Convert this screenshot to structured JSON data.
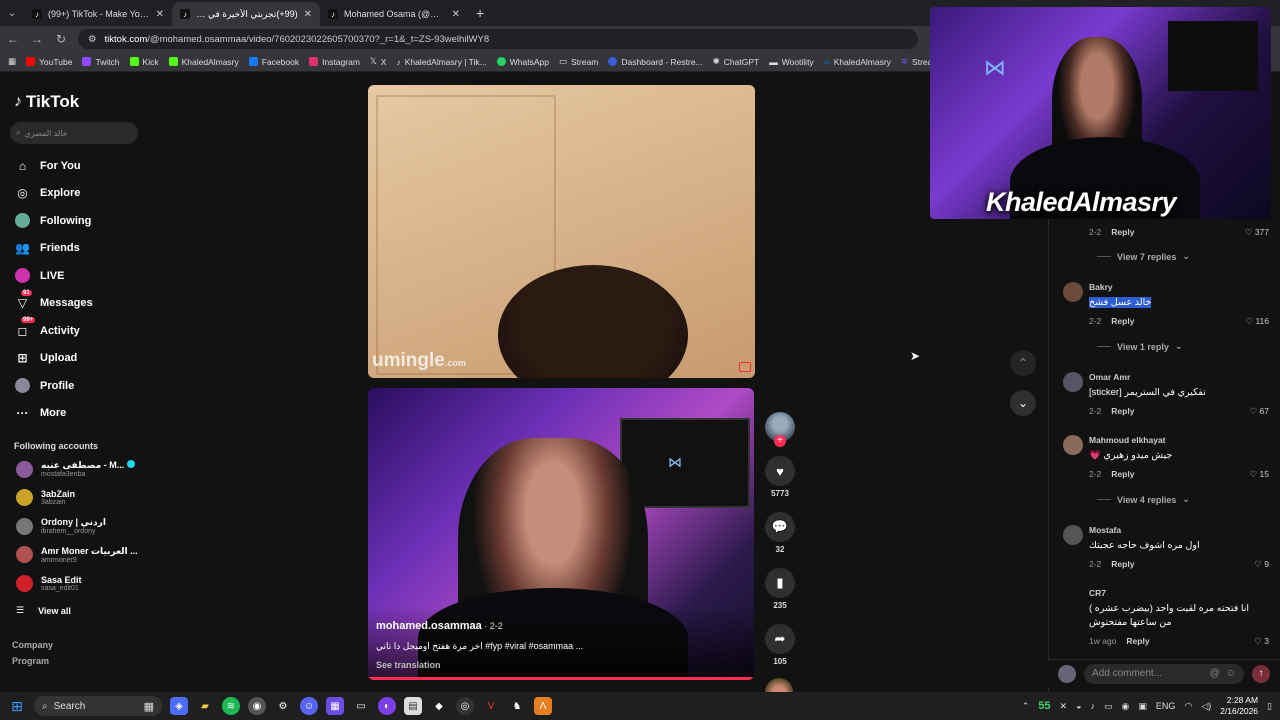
{
  "browser": {
    "tabs": [
      {
        "title": "(99+) TikTok - Make Your Day",
        "active": false
      },
      {
        "title": "(99+)تجربتي الأخيرة في أوميجل |",
        "active": true
      },
      {
        "title": "Mohamed Osama (@mohamed",
        "active": false
      }
    ],
    "new_tab": "+",
    "url_host": "tiktok.com",
    "url_path": "/@mohamed.osammaa/video/7602023022605700370?_r=1&_t=ZS-93welhilWY8",
    "bookmarks": [
      {
        "label": "YouTube",
        "color": "#ff0000"
      },
      {
        "label": "Twitch",
        "color": "#9146ff"
      },
      {
        "label": "Kick",
        "color": "#53fc18"
      },
      {
        "label": "KhaledAlmasry",
        "color": "#53fc18"
      },
      {
        "label": "Facebook",
        "color": "#1877f2"
      },
      {
        "label": "Instagram",
        "color": "#e1306c"
      },
      {
        "label": "X",
        "color": "#ffffff"
      },
      {
        "label": "KhaledAlmasry | Tik...",
        "color": "#111111"
      },
      {
        "label": "WhatsApp",
        "color": "#25d366"
      },
      {
        "label": "Stream",
        "color": "#888888"
      },
      {
        "label": "Dashboard - Restre...",
        "color": "#3b5bdb"
      },
      {
        "label": "ChatGPT",
        "color": "#cccccc"
      },
      {
        "label": "Wootility",
        "color": "#dddddd"
      },
      {
        "label": "KhaledAlmasry",
        "color": "#0a66c2"
      },
      {
        "label": "StreamCharts",
        "color": "#7a5af8"
      }
    ]
  },
  "sidebar": {
    "logo": "TikTok",
    "search_placeholder": "خالد المصري",
    "nav": [
      {
        "label": "For You",
        "icon": "home-icon"
      },
      {
        "label": "Explore",
        "icon": "compass-icon"
      },
      {
        "label": "Following",
        "icon": "following-avatar-icon"
      },
      {
        "label": "Friends",
        "icon": "friends-icon"
      },
      {
        "label": "LIVE",
        "icon": "live-icon"
      },
      {
        "label": "Messages",
        "icon": "messages-icon",
        "badge": "91"
      },
      {
        "label": "Activity",
        "icon": "activity-icon",
        "badge": "99+"
      },
      {
        "label": "Upload",
        "icon": "upload-icon"
      },
      {
        "label": "Profile",
        "icon": "profile-avatar-icon"
      },
      {
        "label": "More",
        "icon": "more-icon"
      }
    ],
    "following_title": "Following accounts",
    "accounts": [
      {
        "name": "مصطفى عنبه - M...",
        "handle": "mostafa3enba",
        "verified": true,
        "color": "#8a5a9a"
      },
      {
        "name": "3abZain",
        "handle": "3abzain",
        "verified": false,
        "color": "#c9a227"
      },
      {
        "name": "Ordony | اردني",
        "handle": "ibrahem__ordony",
        "verified": false,
        "color": "#777777"
      },
      {
        "name": "Amr Moner العربيات ...",
        "handle": "amrmoner9",
        "verified": false,
        "color": "#b05050"
      },
      {
        "name": "Sasa Edit",
        "handle": "sasa_edit01",
        "verified": false,
        "color": "#d0202a"
      }
    ],
    "view_all": "View all",
    "footer": [
      "Company",
      "Program"
    ]
  },
  "video_top": {
    "watermark": "umingle",
    "watermark_suffix": ".com"
  },
  "video": {
    "author": "mohamed.osammaa",
    "date": " · 2-2",
    "caption": "اخر مرة هفتح اوميجل دا تاني #fyp #viral #osammaa ...",
    "translate": "See translation",
    "progress": 1.0
  },
  "actions": {
    "likes": "5773",
    "comments": "32",
    "saves": "235",
    "shares": "105"
  },
  "comments": {
    "items": [
      {
        "date": "2-2",
        "reply": "Reply",
        "likes": "377",
        "replies": "View 7 replies"
      },
      {
        "user": "Bakry",
        "text": "خالد عسل فشخ",
        "date": "2-2",
        "reply": "Reply",
        "likes": "116",
        "replies": "View 1 reply",
        "highlight": true
      },
      {
        "user": "Omar Amr",
        "text": "تفكيري في الستريمر [sticker]",
        "date": "2-2",
        "reply": "Reply",
        "likes": "67"
      },
      {
        "user": "Mahmoud elkhayat",
        "text": "جيش ميدو زهيري 💗",
        "date": "2-2",
        "reply": "Reply",
        "likes": "15",
        "replies": "View 4 replies"
      },
      {
        "user": "Mostafa",
        "text": "اول مره اشوف حاجه عجبتك",
        "date": "2-2",
        "reply": "Reply",
        "likes": "9"
      },
      {
        "user": "CR7",
        "text": "انا فتحته مره لقيت واحد (بيضرب عشره ) من ساعتها مفتحتوش",
        "date": "1w ago",
        "reply": "Reply",
        "likes": "3"
      }
    ],
    "add_placeholder": "Add comment...",
    "mention": "@",
    "emoji": "☺"
  },
  "webcam": {
    "name": "KhaledAlmasry"
  },
  "taskbar": {
    "search": "Search",
    "tray_number": "55",
    "lang": "ENG",
    "time": "2:28 AM",
    "date": "2/16/2026"
  }
}
